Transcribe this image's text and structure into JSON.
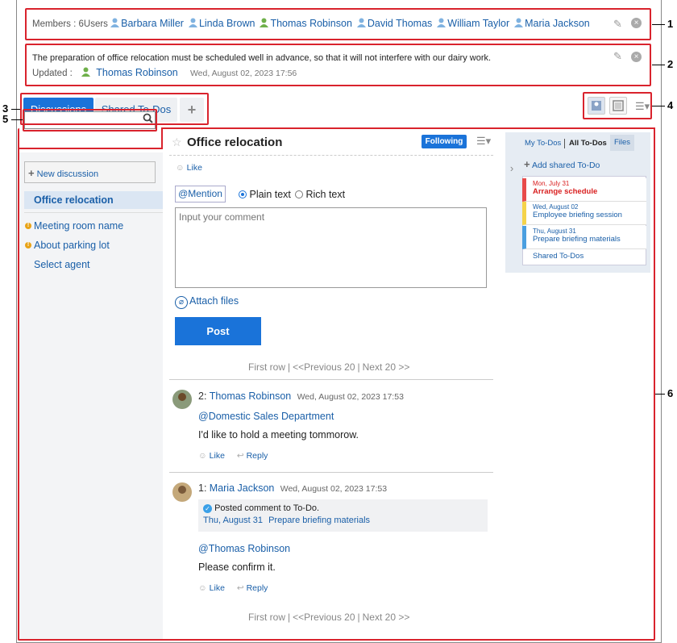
{
  "members": {
    "label": "Members : 6Users",
    "users": [
      "Barbara Miller",
      "Linda Brown",
      "Thomas Robinson",
      "David Thomas",
      "William Taylor",
      "Maria Jackson"
    ]
  },
  "description": {
    "text": "The preparation of office relocation must be scheduled well in advance, so that it will not interfere with our dairy work.",
    "updated_label": "Updated :",
    "updated_user": "Thomas Robinson",
    "updated_time": "Wed, August 02, 2023 17:56"
  },
  "tabs": {
    "discussions": "Discussions",
    "shared": "Shared To-Dos",
    "add": "+"
  },
  "sidebar": {
    "new_discussion": "New discussion",
    "items": [
      "Office relocation",
      "Meeting room name",
      "About parking lot",
      "Select agent"
    ]
  },
  "thread": {
    "title": "Office relocation",
    "following": "Following",
    "like": "Like",
    "mention": "@Mention",
    "plain": "Plain text",
    "rich": "Rich text",
    "comment_placeholder": "Input your comment",
    "attach": "Attach files",
    "post": "Post"
  },
  "pager": {
    "first": "First row",
    "prev": "<<Previous 20",
    "next": "Next 20 >>"
  },
  "comments": [
    {
      "num": "2:",
      "user": "Thomas Robinson",
      "time": "Wed, August 02, 2023 17:53",
      "mention": "@Domestic Sales Department",
      "body": "I'd like to hold a meeting tommorow.",
      "like": "Like",
      "reply": "Reply"
    },
    {
      "num": "1:",
      "user": "Maria Jackson",
      "time": "Wed, August 02, 2023 17:53",
      "notice": "Posted comment to To-Do.",
      "notice_date": "Thu, August 31",
      "notice_task": "Prepare briefing materials",
      "mention": "@Thomas Robinson",
      "body": "Please confirm it.",
      "like": "Like",
      "reply": "Reply"
    }
  ],
  "todo_panel": {
    "tabs": [
      "My To-Dos",
      "All To-Dos",
      "Files"
    ],
    "add": "Add shared To-Do",
    "items": [
      {
        "date": "Mon, July 31",
        "title": "Arrange schedule",
        "color": "#e84a4a"
      },
      {
        "date": "Wed, August 02",
        "title": "Employee briefing session",
        "color": "#f5d34a"
      },
      {
        "date": "Thu, August 31",
        "title": "Prepare briefing materials",
        "color": "#4a9fe0"
      }
    ],
    "footer": "Shared To-Dos"
  },
  "callouts": [
    "1",
    "2",
    "3",
    "4",
    "5",
    "6"
  ],
  "colors": {
    "accent": "#1a73d9",
    "link": "#1a5fa8",
    "callout": "#d9232d",
    "overdue": "#d92020"
  }
}
